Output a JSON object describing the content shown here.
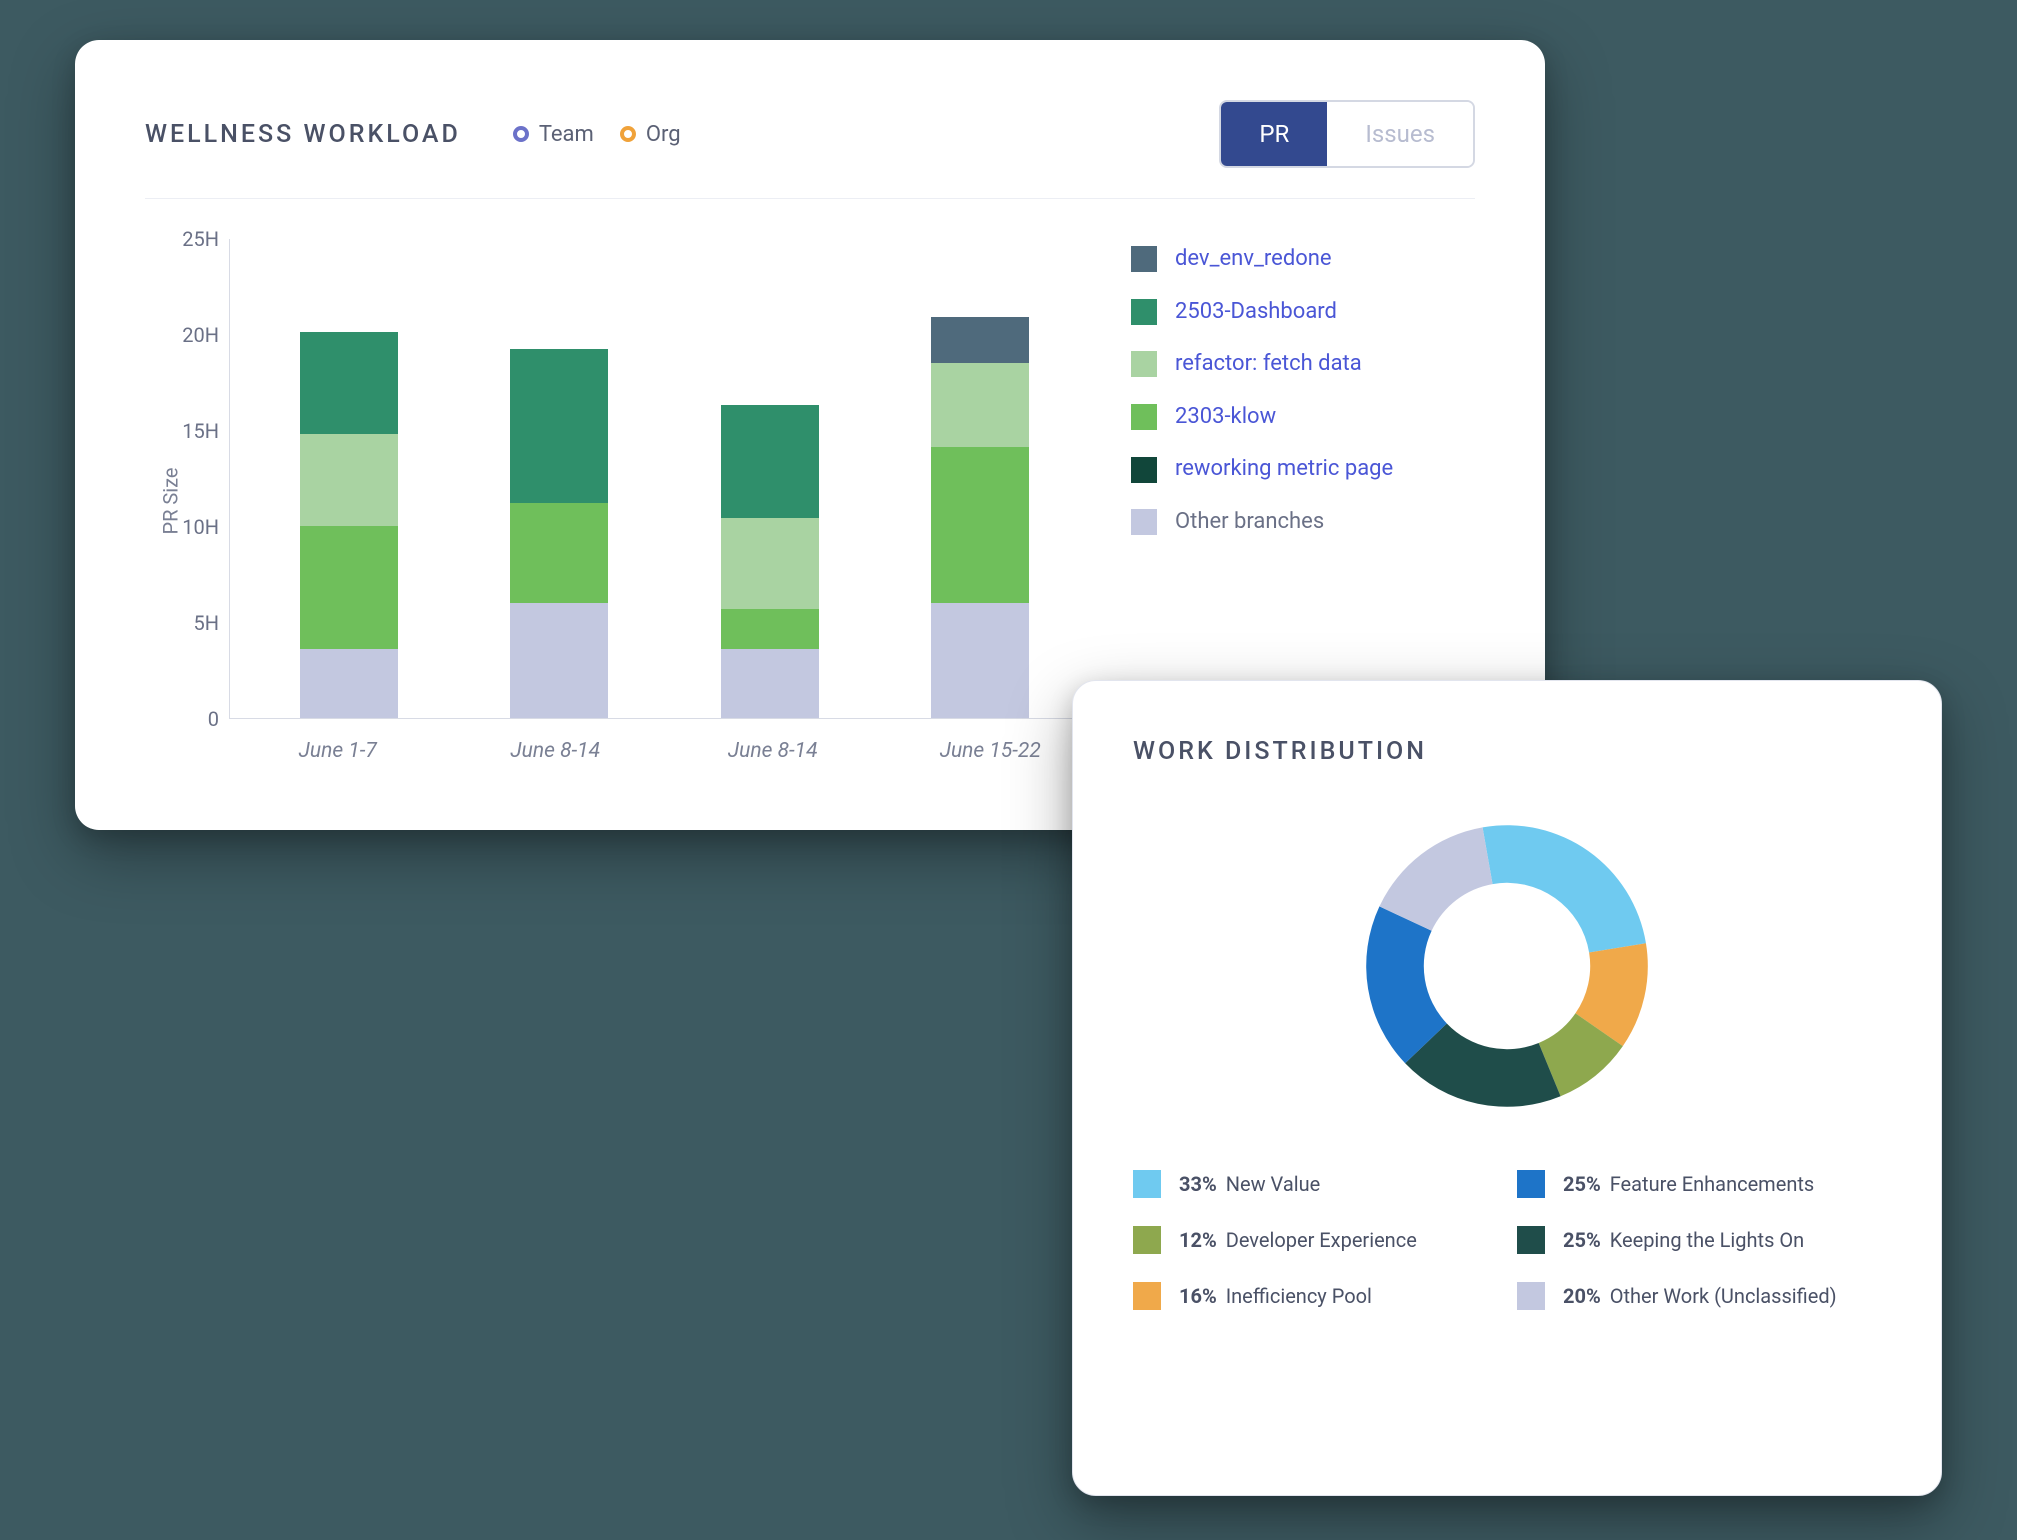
{
  "wellness": {
    "title": "WELLNESS WORKLOAD",
    "scope": [
      {
        "label": "Team",
        "color": "#6c72c9"
      },
      {
        "label": "Org",
        "color": "#f0a23a"
      }
    ],
    "tabs": {
      "pr": "PR",
      "issues": "Issues",
      "active": "pr"
    },
    "ylabel": "PR Size",
    "yticks": [
      "0",
      "5H",
      "10H",
      "15H",
      "20H",
      "25H"
    ],
    "xlabels": [
      "June 1-7",
      "June 8-14",
      "June 8-14",
      "June 15-22"
    ],
    "legend": [
      {
        "key": "other",
        "label": "Other branches",
        "color": "#c3c8e0",
        "muted": true
      },
      {
        "key": "klow",
        "label": "2303-klow",
        "color": "#6fbf5b"
      },
      {
        "key": "refactor",
        "label": "refactor: fetch data",
        "color": "#a9d3a2"
      },
      {
        "key": "dash",
        "label": "2503-Dashboard",
        "color": "#2f8f6b"
      },
      {
        "key": "devenv",
        "label": "dev_env_redone",
        "color": "#4f6a7c"
      },
      {
        "key": "rework",
        "label": "reworking metric page",
        "color": "#11463a"
      }
    ],
    "legend_display_order": [
      "devenv",
      "dash",
      "refactor",
      "klow",
      "rework",
      "other"
    ]
  },
  "distribution": {
    "title": "WORK DISTRIBUTION",
    "items": [
      {
        "pct": "33%",
        "label": "New Value",
        "color": "#6fcaf0",
        "value": 33
      },
      {
        "pct": "25%",
        "label": "Feature Enhancements",
        "color": "#1e74c8",
        "value": 25
      },
      {
        "pct": "12%",
        "label": "Developer Experience",
        "color": "#8ea84e",
        "value": 12
      },
      {
        "pct": "25%",
        "label": "Keeping the Lights On",
        "color": "#1f4d4a",
        "value": 25
      },
      {
        "pct": "16%",
        "label": "Inefficiency Pool",
        "color": "#f0a94a",
        "value": 16
      },
      {
        "pct": "20%",
        "label": "Other Work (Unclassified)",
        "color": "#c3c8e0",
        "value": 20
      }
    ],
    "donut_order": [
      "New Value",
      "Inefficiency Pool",
      "Developer Experience",
      "Keeping the Lights On",
      "Feature Enhancements",
      "Other Work (Unclassified)"
    ]
  },
  "chart_data": [
    {
      "type": "bar",
      "title": "Wellness Workload — PR Size",
      "xlabel": "",
      "ylabel": "PR Size",
      "ylim": [
        0,
        25
      ],
      "yticks": [
        0,
        5,
        10,
        15,
        20,
        25
      ],
      "categories": [
        "June 1-7",
        "June 8-14",
        "June 8-14",
        "June 15-22"
      ],
      "stacked": true,
      "series": [
        {
          "name": "Other branches",
          "color": "#c3c8e0",
          "values": [
            3.6,
            6.0,
            3.6,
            6.0
          ]
        },
        {
          "name": "2303-klow",
          "color": "#6fbf5b",
          "values": [
            6.4,
            5.2,
            2.1,
            8.1
          ]
        },
        {
          "name": "refactor: fetch data",
          "color": "#a9d3a2",
          "values": [
            4.8,
            0.0,
            4.7,
            4.4
          ]
        },
        {
          "name": "2503-Dashboard",
          "color": "#2f8f6b",
          "values": [
            5.3,
            8.0,
            5.9,
            0.0
          ]
        },
        {
          "name": "dev_env_redone",
          "color": "#4f6a7c",
          "values": [
            0.0,
            0.0,
            0.0,
            2.4
          ]
        },
        {
          "name": "reworking metric page",
          "color": "#11463a",
          "values": [
            0.0,
            0.0,
            0.0,
            0.0
          ]
        }
      ]
    },
    {
      "type": "pie",
      "title": "Work Distribution",
      "series": [
        {
          "name": "New Value",
          "value": 33,
          "color": "#6fcaf0"
        },
        {
          "name": "Inefficiency Pool",
          "value": 16,
          "color": "#f0a94a"
        },
        {
          "name": "Developer Experience",
          "value": 12,
          "color": "#8ea84e"
        },
        {
          "name": "Keeping the Lights On",
          "value": 25,
          "color": "#1f4d4a"
        },
        {
          "name": "Feature Enhancements",
          "value": 25,
          "color": "#1e74c8"
        },
        {
          "name": "Other Work (Unclassified)",
          "value": 20,
          "color": "#c3c8e0"
        }
      ]
    }
  ]
}
